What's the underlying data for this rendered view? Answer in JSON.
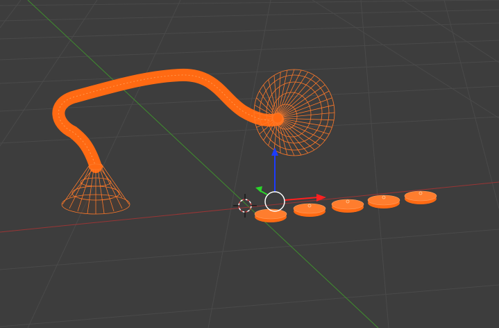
{
  "viewport": {
    "background": "#3d3d3d",
    "grid_color": "#4a4a4a",
    "x_axis_color": "#b03a3a",
    "y_axis_color": "#3f8f2e",
    "selection_color": "#ff6a13",
    "wire_color": "#ff8a3a",
    "gizmo": {
      "z_arrow_color": "#1c3cff",
      "x_arrow_color": "#ff2020",
      "y_handle_color": "#2ad62a",
      "center_ring_color": "#ffffff",
      "cursor_icon": "3d-cursor-icon"
    }
  },
  "objects": [
    {
      "name": "tube-curve",
      "type": "curve",
      "selected": true
    },
    {
      "name": "horn-cone",
      "type": "mesh",
      "selected": true
    },
    {
      "name": "disk-fan",
      "type": "mesh",
      "selected": true
    },
    {
      "name": "disk-1",
      "type": "mesh",
      "selected": true
    },
    {
      "name": "disk-2",
      "type": "mesh",
      "selected": true
    },
    {
      "name": "disk-3",
      "type": "mesh",
      "selected": true
    },
    {
      "name": "disk-4",
      "type": "mesh",
      "selected": true
    },
    {
      "name": "disk-5",
      "type": "mesh",
      "selected": true
    }
  ]
}
